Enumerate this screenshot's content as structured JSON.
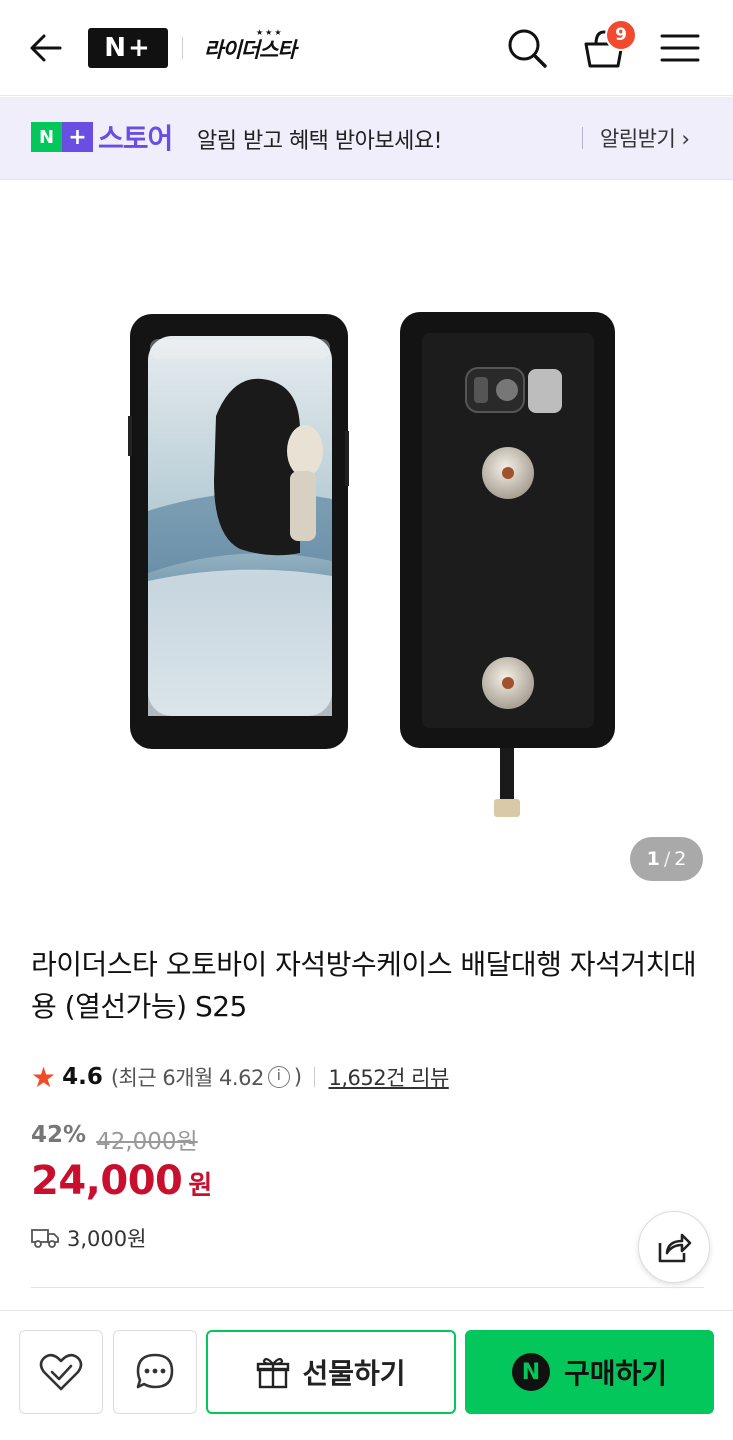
{
  "header": {
    "logo_text": "N+",
    "store_name": "라이더스타",
    "cart_count": "9"
  },
  "banner": {
    "logo_n": "N",
    "logo_plus": "+",
    "store_label": "스토어",
    "message": "알림 받고 혜택 받아보세요!",
    "action": "알림받기 ›"
  },
  "gallery": {
    "current": "1",
    "separator": "/",
    "total": "2"
  },
  "product": {
    "title": "라이더스타 오토바이 자석방수케이스 배달대행 자석거치대용 (열선가능) S25",
    "rating": "4.6",
    "recent_prefix": "(최근 6개월 4.62",
    "recent_suffix": ")",
    "reviews": "1,652건 리뷰",
    "discount_rate": "42%",
    "original_price": "42,000원",
    "price": "24,000",
    "price_unit": "원",
    "shipping": "3,000원"
  },
  "bottom_bar": {
    "gift_label": "선물하기",
    "buy_label": "구매하기",
    "npay_icon": "N"
  },
  "colors": {
    "brand_green": "#03c75a",
    "brand_purple": "#6a4ee3",
    "price_red": "#c8102e",
    "badge_red": "#f24a2e"
  }
}
